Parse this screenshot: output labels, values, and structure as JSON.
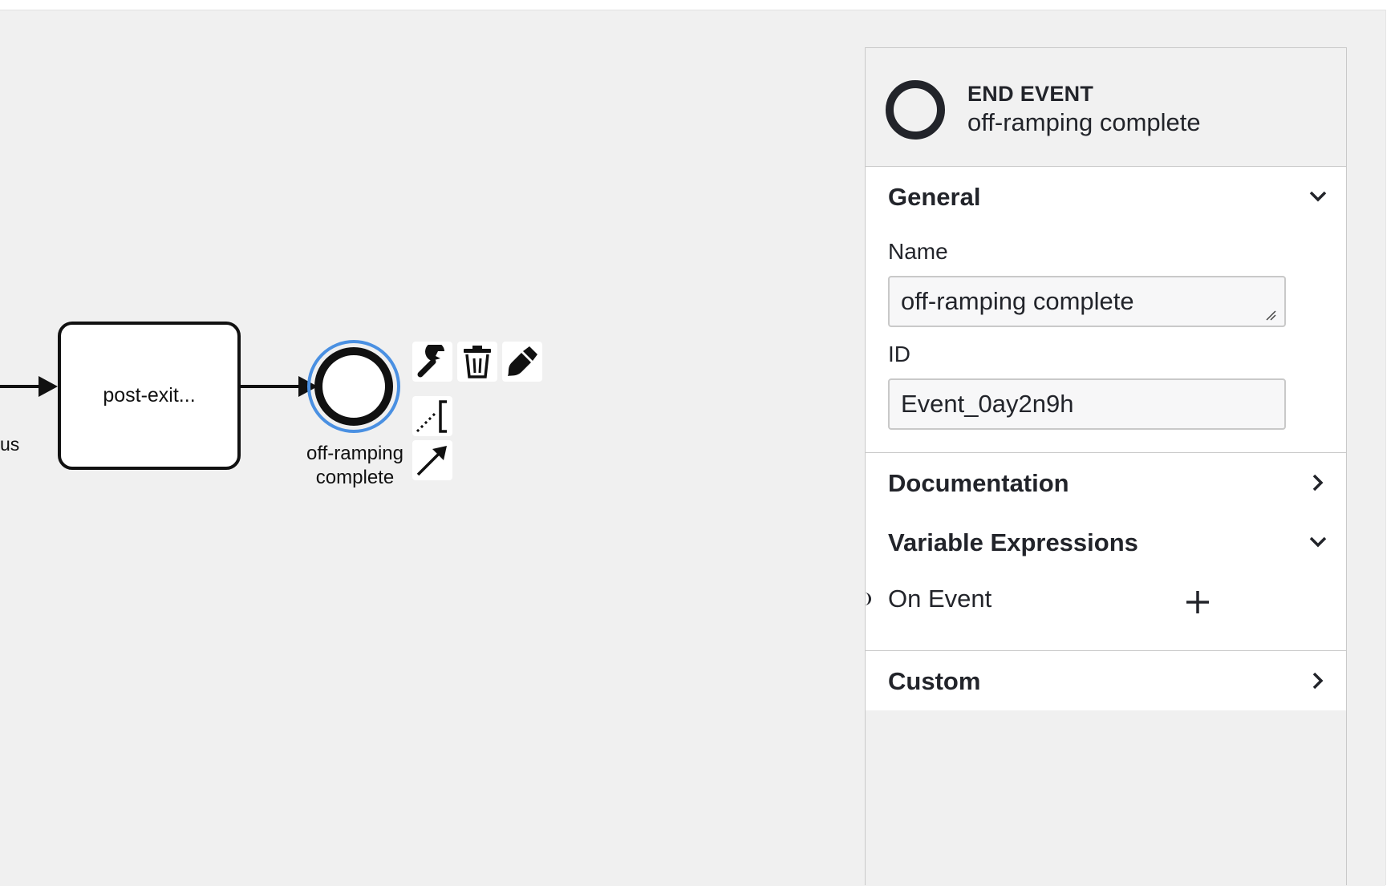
{
  "diagram": {
    "left_fragment_label": "us",
    "task_label": "post-exit...",
    "end_event_label_line1": "off-ramping",
    "end_event_label_line2": "complete",
    "selection_color": "#4a90e2",
    "context_pad": [
      "wrench-icon",
      "trash-icon",
      "paintbrush-icon",
      "text-annotation-icon",
      "connect-arrow-icon"
    ]
  },
  "panel": {
    "header": {
      "type": "END EVENT",
      "name": "off-ramping complete"
    },
    "groups": {
      "general": {
        "title": "General",
        "name_label": "Name",
        "name_value": "off-ramping complete",
        "id_label": "ID",
        "id_value": "Event_0ay2n9h"
      },
      "documentation": {
        "title": "Documentation"
      },
      "variable_expressions": {
        "title": "Variable Expressions",
        "item_label": "On Event"
      },
      "custom": {
        "title": "Custom"
      }
    }
  }
}
